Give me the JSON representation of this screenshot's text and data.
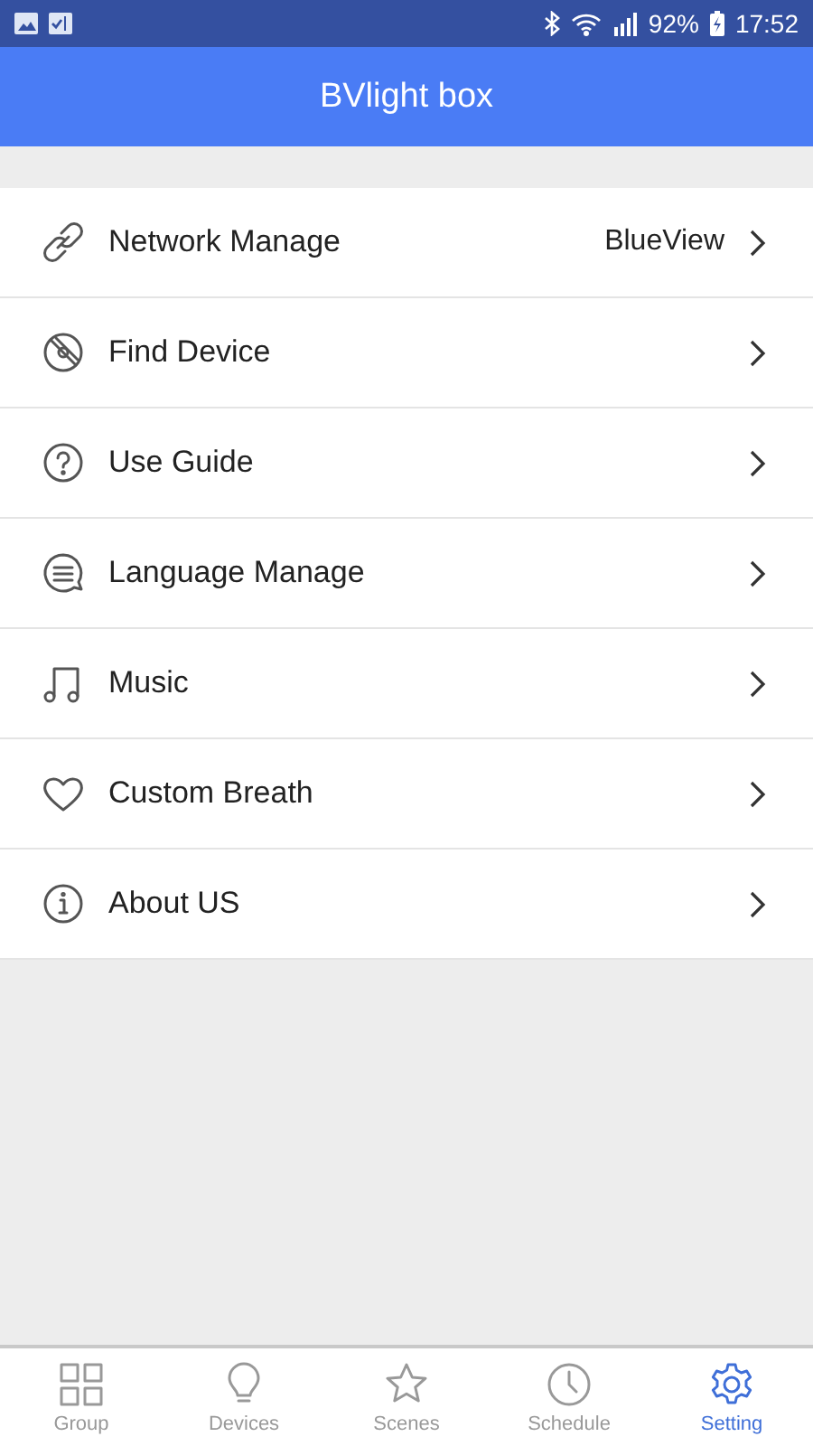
{
  "status_bar": {
    "battery": "92%",
    "time": "17:52"
  },
  "header": {
    "title": "BVlight box"
  },
  "menu": [
    {
      "kind": "link",
      "label": "Network Manage",
      "value": "BlueView"
    },
    {
      "kind": "disc",
      "label": "Find Device"
    },
    {
      "kind": "question",
      "label": "Use Guide"
    },
    {
      "kind": "chat",
      "label": "Language Manage"
    },
    {
      "kind": "music",
      "label": "Music"
    },
    {
      "kind": "heart",
      "label": "Custom Breath"
    },
    {
      "kind": "info",
      "label": "About US"
    }
  ],
  "tabs": [
    {
      "kind": "grid",
      "label": "Group",
      "selected": false
    },
    {
      "kind": "bulb",
      "label": "Devices",
      "selected": false
    },
    {
      "kind": "star",
      "label": "Scenes",
      "selected": false
    },
    {
      "kind": "clock",
      "label": "Schedule",
      "selected": false
    },
    {
      "kind": "gear",
      "label": "Setting",
      "selected": true
    }
  ]
}
